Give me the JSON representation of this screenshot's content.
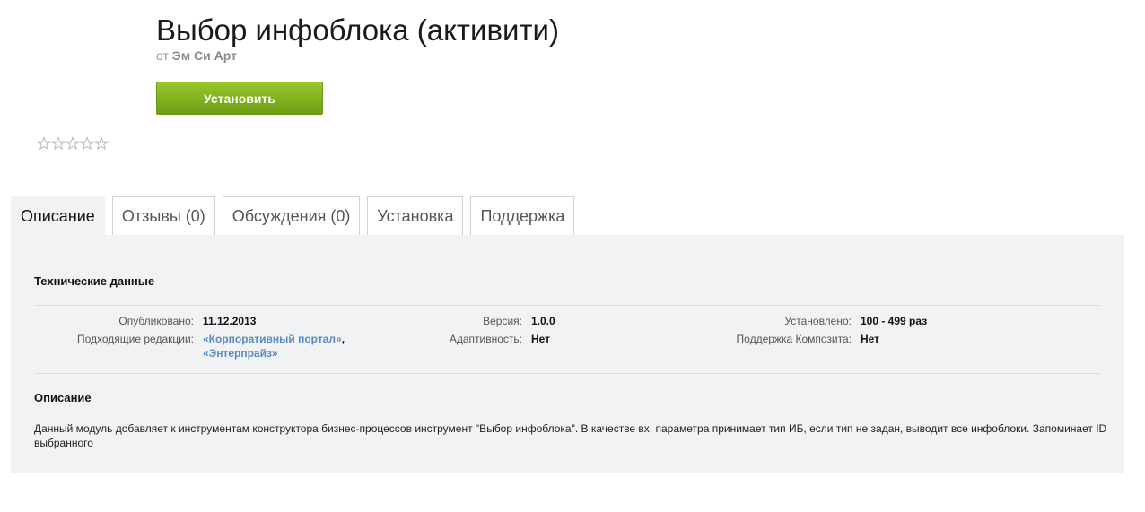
{
  "header": {
    "title": "Выбор инфоблока (активити)",
    "by_prefix": "от",
    "author": "Эм Си Арт"
  },
  "actions": {
    "install_label": "Установить"
  },
  "rating": {
    "stars_total": 5,
    "stars_filled": 0,
    "icon": "star-outline-icon"
  },
  "tabs": [
    {
      "label": "Описание",
      "active": true
    },
    {
      "label": "Отзывы (0)",
      "active": false
    },
    {
      "label": "Обсуждения (0)",
      "active": false
    },
    {
      "label": "Установка",
      "active": false
    },
    {
      "label": "Поддержка",
      "active": false
    }
  ],
  "tech": {
    "heading": "Технические данные",
    "published_label": "Опубликовано:",
    "published_value": "11.12.2013",
    "editions_label": "Подходящие редакции:",
    "edition_1": "«Корпоративный портал»",
    "edition_sep": ",",
    "edition_2": "«Энтерпрайз»",
    "version_label": "Версия:",
    "version_value": "1.0.0",
    "adaptive_label": "Адаптивность:",
    "adaptive_value": "Нет",
    "installed_label": "Установлено:",
    "installed_value": "100 - 499 раз",
    "composite_label": "Поддержка Композита:",
    "composite_value": "Нет"
  },
  "description": {
    "heading": "Описание",
    "text": "Данный модуль добавляет к инструментам конструктора бизнес-процессов инструмент \"Выбор инфоблока\". В качестве вх. параметра принимает тип ИБ, если тип не задан, выводит все инфоблоки. Запоминает ID выбранного"
  },
  "colors": {
    "install_button": "#7fb01f",
    "link": "#5b8bc4",
    "panel_bg": "#f1f2f3"
  }
}
